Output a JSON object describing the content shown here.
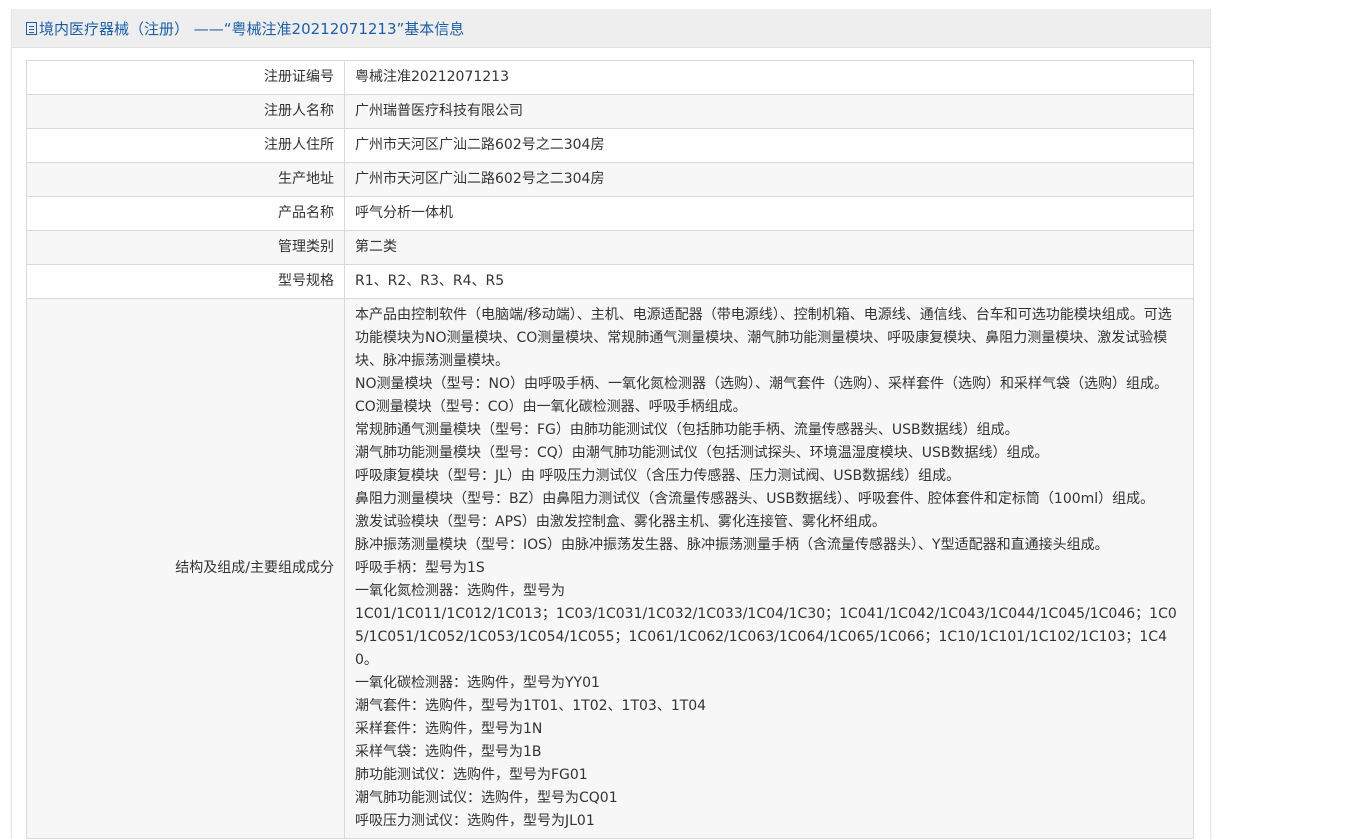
{
  "header": {
    "title": "境内医疗器械（注册） ——“粤械注准20212071213”基本信息"
  },
  "rows": [
    {
      "label": "注册证编号",
      "value": "粤械注准20212071213"
    },
    {
      "label": "注册人名称",
      "value": "广州瑞普医疗科技有限公司"
    },
    {
      "label": "注册人住所",
      "value": "广州市天河区广汕二路602号之二304房"
    },
    {
      "label": "生产地址",
      "value": "广州市天河区广汕二路602号之二304房"
    },
    {
      "label": "产品名称",
      "value": "呼气分析一体机"
    },
    {
      "label": "管理类别",
      "value": "第二类"
    },
    {
      "label": "型号规格",
      "value": "R1、R2、R3、R4、R5"
    }
  ],
  "structure": {
    "label": "结构及组成/主要组成成分",
    "lines": [
      "本产品由控制软件（电脑端/移动端）、主机、电源适配器（带电源线）、控制机箱、电源线、通信线、台车和可选功能模块组成。可选功能模块为NO测量模块、CO测量模块、常规肺通气测量模块、潮气肺功能测量模块、呼吸康复模块、鼻阻力测量模块、激发试验模块、脉冲振荡测量模块。",
      "NO测量模块（型号：NO）由呼吸手柄、一氧化氮检测器（选购）、潮气套件（选购）、采样套件（选购）和采样气袋（选购）组成。",
      "CO测量模块（型号：CO）由一氧化碳检测器、呼吸手柄组成。",
      "常规肺通气测量模块（型号：FG）由肺功能测试仪（包括肺功能手柄、流量传感器头、USB数据线）组成。",
      "潮气肺功能测量模块（型号：CQ）由潮气肺功能测试仪（包括测试探头、环境温湿度模块、USB数据线）组成。",
      "呼吸康复模块（型号：JL）由 呼吸压力测试仪（含压力传感器、压力测试阀、USB数据线）组成。",
      "鼻阻力测量模块（型号：BZ）由鼻阻力测试仪（含流量传感器头、USB数据线）、呼吸套件、腔体套件和定标筒（100ml）组成。",
      "激发试验模块（型号：APS）由激发控制盒、雾化器主机、雾化连接管、雾化杯组成。",
      "脉冲振荡测量模块（型号：IOS）由脉冲振荡发生器、脉冲振荡测量手柄（含流量传感器头）、Y型适配器和直通接头组成。",
      "呼吸手柄：型号为1S",
      "一氧化氮检测器：选购件，型号为",
      "1C01/1C011/1C012/1C013；1C03/1C031/1C032/1C033/1C04/1C30；1C041/1C042/1C043/1C044/1C045/1C046；1C05/1C051/1C052/1C053/1C054/1C055；1C061/1C062/1C063/1C064/1C065/1C066；1C10/1C101/1C102/1C103；1C40。",
      "一氧化碳检测器：选购件，型号为YY01",
      "潮气套件：选购件，型号为1T01、1T02、1T03、1T04",
      "采样套件：选购件，型号为1N",
      "采样气袋：选购件，型号为1B",
      "肺功能测试仪：选购件，型号为FG01",
      "潮气肺功能测试仪：选购件，型号为CQ01",
      "呼吸压力测试仪：选购件，型号为JL01"
    ]
  }
}
